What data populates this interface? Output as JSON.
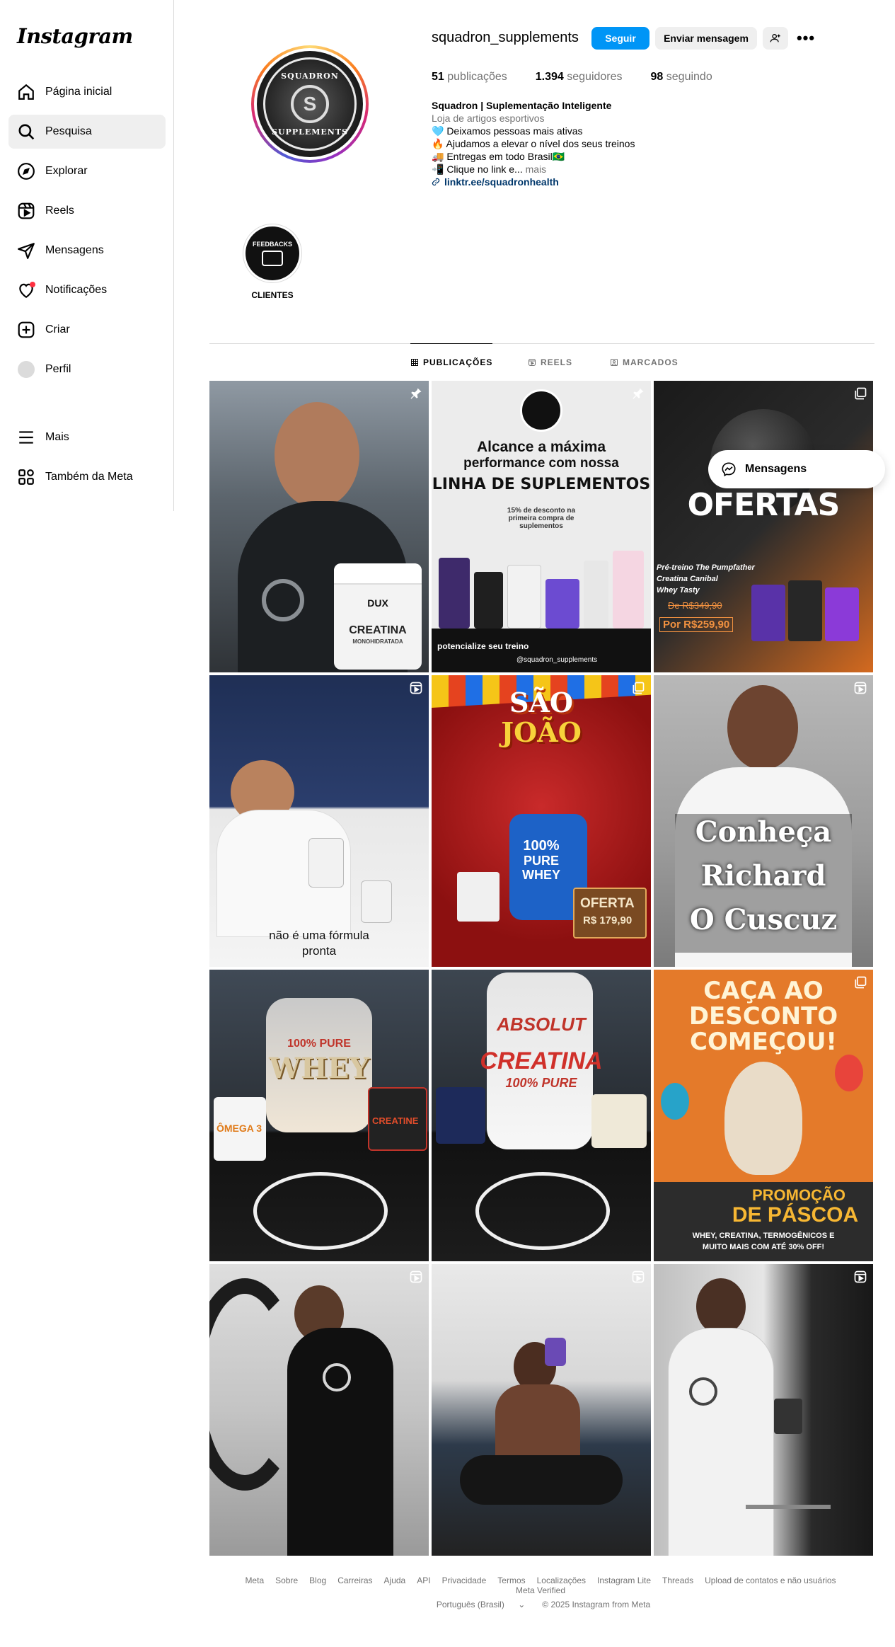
{
  "brand": {
    "logo_text": "Instagram"
  },
  "sidebar": {
    "items": [
      {
        "label": "Página inicial",
        "icon": "home-icon"
      },
      {
        "label": "Pesquisa",
        "icon": "search-icon"
      },
      {
        "label": "Explorar",
        "icon": "compass-icon"
      },
      {
        "label": "Reels",
        "icon": "reels-icon"
      },
      {
        "label": "Mensagens",
        "icon": "send-icon"
      },
      {
        "label": "Notificações",
        "icon": "heart-icon"
      },
      {
        "label": "Criar",
        "icon": "plus-square-icon"
      },
      {
        "label": "Perfil",
        "icon": "avatar"
      },
      {
        "label": "Mais",
        "icon": "menu-icon"
      },
      {
        "label": "Também da Meta",
        "icon": "meta-apps-icon"
      }
    ],
    "active": "Pesquisa"
  },
  "profile": {
    "username": "squadron_supplements",
    "follow_label": "Seguir",
    "message_label": "Enviar mensagem",
    "more_label": "•••",
    "logo_top": "SQUADRON",
    "logo_mark": "S",
    "logo_bottom": "SUPPLEMENTS",
    "stats": {
      "posts_count": "51",
      "posts_label": "publicações",
      "followers_count": "1.394",
      "followers_label": "seguidores",
      "following_count": "98",
      "following_label": "seguindo"
    },
    "bio": {
      "name": "Squadron | Suplementação Inteligente",
      "category": "Loja de artigos esportivos",
      "line1": "🩵 Deixamos pessoas mais ativas",
      "line2": "🔥 Ajudamos a elevar o nível dos seus treinos",
      "line3": "🚚 Entregas em todo Brasil🇧🇷",
      "line4": "📲 Clique no link e...",
      "more": "mais",
      "link": "linktr.ee/squadronhealth"
    }
  },
  "highlights": [
    {
      "label": "CLIENTES",
      "cover_text": "FEEDBACKS"
    }
  ],
  "tabs": {
    "posts": "PUBLICAÇÕES",
    "reels": "REELS",
    "tagged": "MARCADOS"
  },
  "posts": [
    {
      "badge": "pin-icon",
      "caption_lines": [
        "DUX",
        "CREATINA",
        "MONOHIDRATADA"
      ]
    },
    {
      "badge": "pin-icon",
      "caption_lines": [
        "Alcance a máxima",
        "performance com nossa",
        "LINHA DE SUPLEMENTOS",
        "15% de desconto na primeira compra de suplementos",
        "potencialize seu treino",
        "@squadron_supplements"
      ]
    },
    {
      "badge": "carousel-icon",
      "caption_lines": [
        "OFERTAS",
        "Pré-treino The Pumpfather",
        "Creatina Canibal",
        "Whey Tasty",
        "De R$349,90",
        "Por R$259,90"
      ]
    },
    {
      "badge": "reels-icon",
      "caption_lines": [
        "não é uma fórmula",
        "pronta"
      ]
    },
    {
      "badge": "carousel-icon",
      "caption_lines": [
        "SÃO",
        "JOÃO",
        "100%",
        "PURE",
        "WHEY",
        "OFERTA",
        "R$ 179,90"
      ]
    },
    {
      "badge": "reels-icon",
      "caption_lines": [
        "Conheça",
        "Richard",
        "O Cuscuz"
      ]
    },
    {
      "badge": "",
      "caption_lines": [
        "100% PURE",
        "WHEY",
        "ÔMEGA 3",
        "CREATINE"
      ]
    },
    {
      "badge": "",
      "caption_lines": [
        "ABSOLUT",
        "CREATINA",
        "100% PURE"
      ]
    },
    {
      "badge": "carousel-icon",
      "caption_lines": [
        "CAÇA AO",
        "DESCONTO",
        "COMEÇOU!",
        "PROMOÇÃO",
        "DE PÁSCOA",
        "WHEY, CREATINA, TERMOGÊNICOS E",
        "MUITO MAIS COM ATÉ 30% OFF!"
      ]
    },
    {
      "badge": "reels-icon",
      "caption_lines": []
    },
    {
      "badge": "reels-icon",
      "caption_lines": []
    },
    {
      "badge": "reels-icon",
      "caption_lines": []
    }
  ],
  "floating_messages": {
    "label": "Mensagens"
  },
  "footer": {
    "links": [
      "Meta",
      "Sobre",
      "Blog",
      "Carreiras",
      "Ajuda",
      "API",
      "Privacidade",
      "Termos",
      "Localizações",
      "Instagram Lite",
      "Threads",
      "Upload de contatos e não usuários",
      "Meta Verified"
    ],
    "language": "Português (Brasil)",
    "copyright": "© 2025 Instagram from Meta"
  },
  "colors": {
    "follow_button": "#0095f6",
    "secondary_button": "#efefef",
    "link": "#00376b",
    "muted": "#737373",
    "notification_dot": "#ff3040"
  }
}
